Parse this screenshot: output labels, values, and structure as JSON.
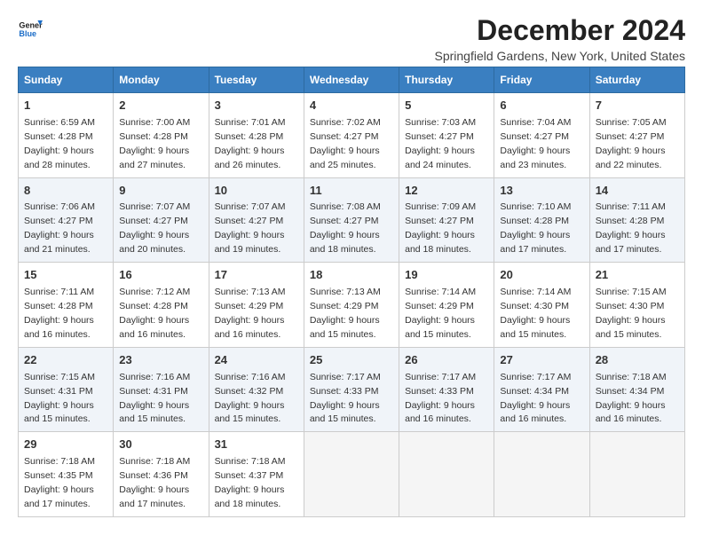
{
  "header": {
    "logo_line1": "General",
    "logo_line2": "Blue",
    "title": "December 2024",
    "subtitle": "Springfield Gardens, New York, United States"
  },
  "days_of_week": [
    "Sunday",
    "Monday",
    "Tuesday",
    "Wednesday",
    "Thursday",
    "Friday",
    "Saturday"
  ],
  "weeks": [
    [
      {
        "day": 1,
        "sunrise": "6:59 AM",
        "sunset": "4:28 PM",
        "daylight": "9 hours and 28 minutes."
      },
      {
        "day": 2,
        "sunrise": "7:00 AM",
        "sunset": "4:28 PM",
        "daylight": "9 hours and 27 minutes."
      },
      {
        "day": 3,
        "sunrise": "7:01 AM",
        "sunset": "4:28 PM",
        "daylight": "9 hours and 26 minutes."
      },
      {
        "day": 4,
        "sunrise": "7:02 AM",
        "sunset": "4:27 PM",
        "daylight": "9 hours and 25 minutes."
      },
      {
        "day": 5,
        "sunrise": "7:03 AM",
        "sunset": "4:27 PM",
        "daylight": "9 hours and 24 minutes."
      },
      {
        "day": 6,
        "sunrise": "7:04 AM",
        "sunset": "4:27 PM",
        "daylight": "9 hours and 23 minutes."
      },
      {
        "day": 7,
        "sunrise": "7:05 AM",
        "sunset": "4:27 PM",
        "daylight": "9 hours and 22 minutes."
      }
    ],
    [
      {
        "day": 8,
        "sunrise": "7:06 AM",
        "sunset": "4:27 PM",
        "daylight": "9 hours and 21 minutes."
      },
      {
        "day": 9,
        "sunrise": "7:07 AM",
        "sunset": "4:27 PM",
        "daylight": "9 hours and 20 minutes."
      },
      {
        "day": 10,
        "sunrise": "7:07 AM",
        "sunset": "4:27 PM",
        "daylight": "9 hours and 19 minutes."
      },
      {
        "day": 11,
        "sunrise": "7:08 AM",
        "sunset": "4:27 PM",
        "daylight": "9 hours and 18 minutes."
      },
      {
        "day": 12,
        "sunrise": "7:09 AM",
        "sunset": "4:27 PM",
        "daylight": "9 hours and 18 minutes."
      },
      {
        "day": 13,
        "sunrise": "7:10 AM",
        "sunset": "4:28 PM",
        "daylight": "9 hours and 17 minutes."
      },
      {
        "day": 14,
        "sunrise": "7:11 AM",
        "sunset": "4:28 PM",
        "daylight": "9 hours and 17 minutes."
      }
    ],
    [
      {
        "day": 15,
        "sunrise": "7:11 AM",
        "sunset": "4:28 PM",
        "daylight": "9 hours and 16 minutes."
      },
      {
        "day": 16,
        "sunrise": "7:12 AM",
        "sunset": "4:28 PM",
        "daylight": "9 hours and 16 minutes."
      },
      {
        "day": 17,
        "sunrise": "7:13 AM",
        "sunset": "4:29 PM",
        "daylight": "9 hours and 16 minutes."
      },
      {
        "day": 18,
        "sunrise": "7:13 AM",
        "sunset": "4:29 PM",
        "daylight": "9 hours and 15 minutes."
      },
      {
        "day": 19,
        "sunrise": "7:14 AM",
        "sunset": "4:29 PM",
        "daylight": "9 hours and 15 minutes."
      },
      {
        "day": 20,
        "sunrise": "7:14 AM",
        "sunset": "4:30 PM",
        "daylight": "9 hours and 15 minutes."
      },
      {
        "day": 21,
        "sunrise": "7:15 AM",
        "sunset": "4:30 PM",
        "daylight": "9 hours and 15 minutes."
      }
    ],
    [
      {
        "day": 22,
        "sunrise": "7:15 AM",
        "sunset": "4:31 PM",
        "daylight": "9 hours and 15 minutes."
      },
      {
        "day": 23,
        "sunrise": "7:16 AM",
        "sunset": "4:31 PM",
        "daylight": "9 hours and 15 minutes."
      },
      {
        "day": 24,
        "sunrise": "7:16 AM",
        "sunset": "4:32 PM",
        "daylight": "9 hours and 15 minutes."
      },
      {
        "day": 25,
        "sunrise": "7:17 AM",
        "sunset": "4:33 PM",
        "daylight": "9 hours and 15 minutes."
      },
      {
        "day": 26,
        "sunrise": "7:17 AM",
        "sunset": "4:33 PM",
        "daylight": "9 hours and 16 minutes."
      },
      {
        "day": 27,
        "sunrise": "7:17 AM",
        "sunset": "4:34 PM",
        "daylight": "9 hours and 16 minutes."
      },
      {
        "day": 28,
        "sunrise": "7:18 AM",
        "sunset": "4:34 PM",
        "daylight": "9 hours and 16 minutes."
      }
    ],
    [
      {
        "day": 29,
        "sunrise": "7:18 AM",
        "sunset": "4:35 PM",
        "daylight": "9 hours and 17 minutes."
      },
      {
        "day": 30,
        "sunrise": "7:18 AM",
        "sunset": "4:36 PM",
        "daylight": "9 hours and 17 minutes."
      },
      {
        "day": 31,
        "sunrise": "7:18 AM",
        "sunset": "4:37 PM",
        "daylight": "9 hours and 18 minutes."
      },
      null,
      null,
      null,
      null
    ]
  ],
  "labels": {
    "sunrise": "Sunrise:",
    "sunset": "Sunset:",
    "daylight": "Daylight:"
  }
}
